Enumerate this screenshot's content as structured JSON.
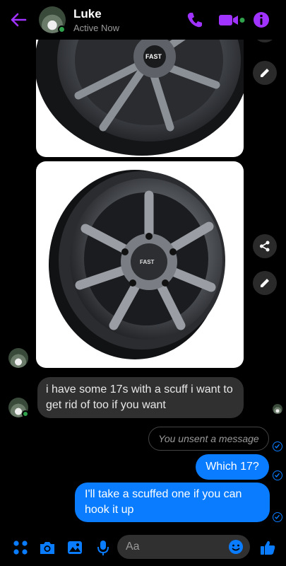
{
  "header": {
    "contact_name": "Luke",
    "status": "Active Now"
  },
  "messages": {
    "incoming": "i have some 17s with a scuff i want to get rid of too if you want",
    "unsent": "You unsent a message",
    "outgoing_1": "Which 17?",
    "outgoing_2": "I'll take a scuffed one if you can hook it up"
  },
  "composer": {
    "placeholder": "Aa"
  },
  "photos": {
    "wheel_1_logo": "FAST",
    "wheel_2_logo": "FAST"
  },
  "colors": {
    "accent": "#a033ff",
    "bubble_blue": "#0a7cff",
    "online_green": "#31a24c"
  }
}
